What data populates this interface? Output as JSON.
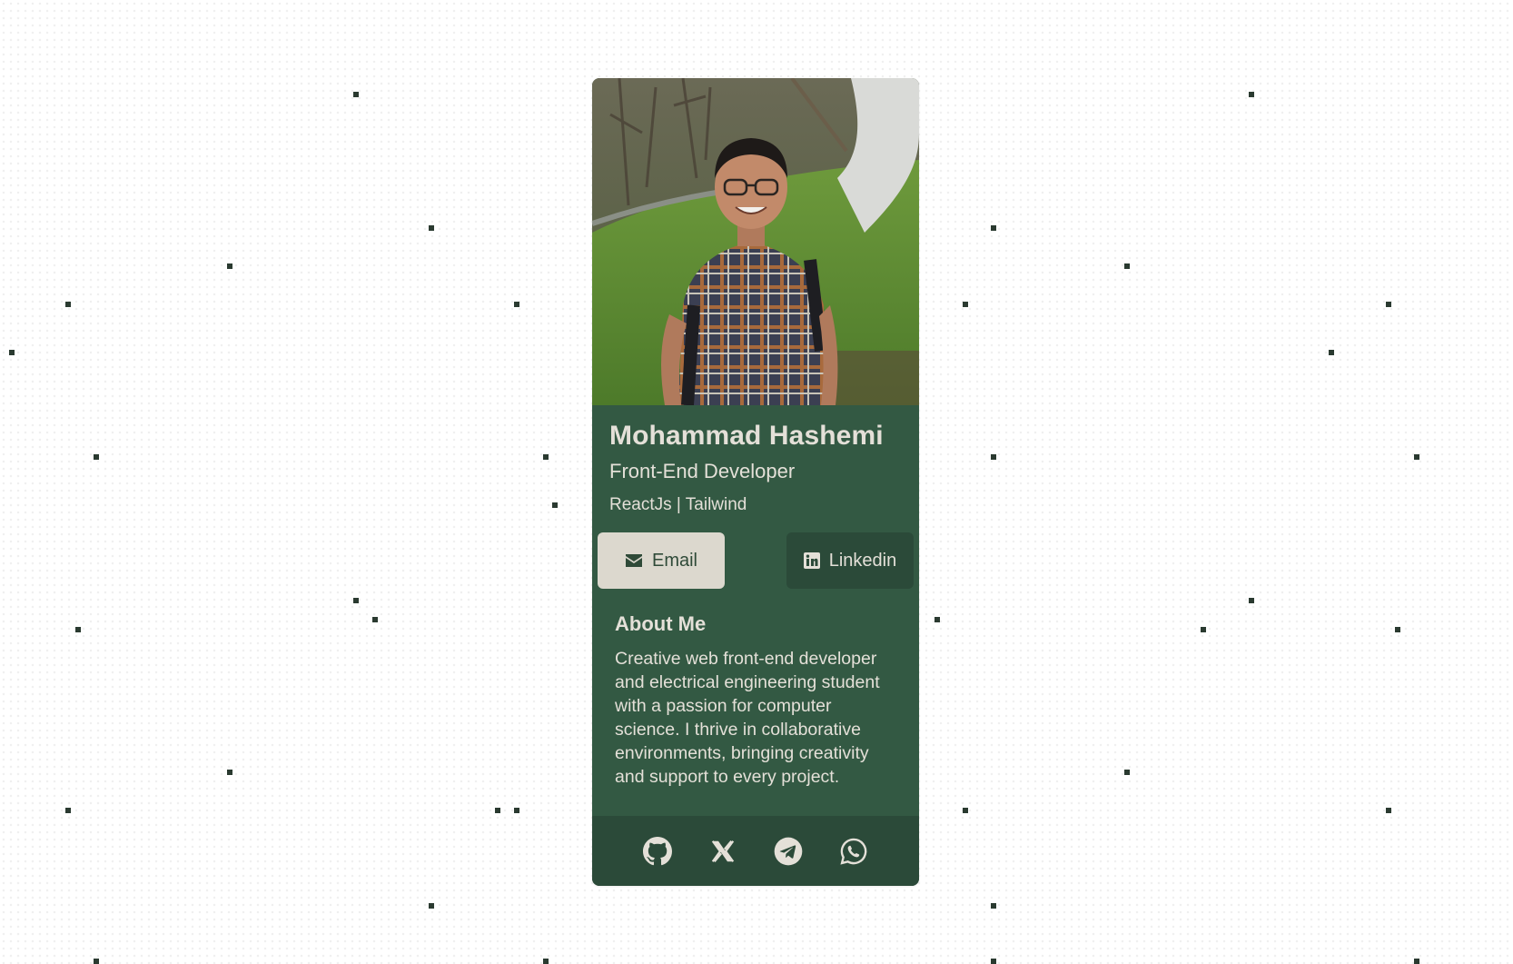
{
  "profile": {
    "name": "Mohammad Hashemi",
    "role": "Front-End Developer",
    "stack": "ReactJs | Tailwind",
    "photo_icon": "profile-photo"
  },
  "buttons": {
    "email_label": "Email",
    "email_icon": "envelope-icon",
    "linkedin_label": "Linkedin",
    "linkedin_icon": "linkedin-icon"
  },
  "about": {
    "heading": "About Me",
    "text": "Creative web front-end developer and electrical engineering student with a passion for computer science. I thrive in collaborative environments, bringing creativity and support to every project."
  },
  "social_links": [
    {
      "name": "github",
      "icon": "github-icon"
    },
    {
      "name": "x",
      "icon": "x-icon"
    },
    {
      "name": "telegram",
      "icon": "telegram-icon"
    },
    {
      "name": "whatsapp",
      "icon": "whatsapp-icon"
    }
  ],
  "colors": {
    "card_bg": "#335943",
    "footer_bg": "#2b4a39",
    "text": "#e4e0d8",
    "email_button_bg": "#dcd8ce",
    "linkedin_button_bg": "#2b4a39",
    "page_bg": "#ffffff",
    "dot": "#2a3a30"
  }
}
